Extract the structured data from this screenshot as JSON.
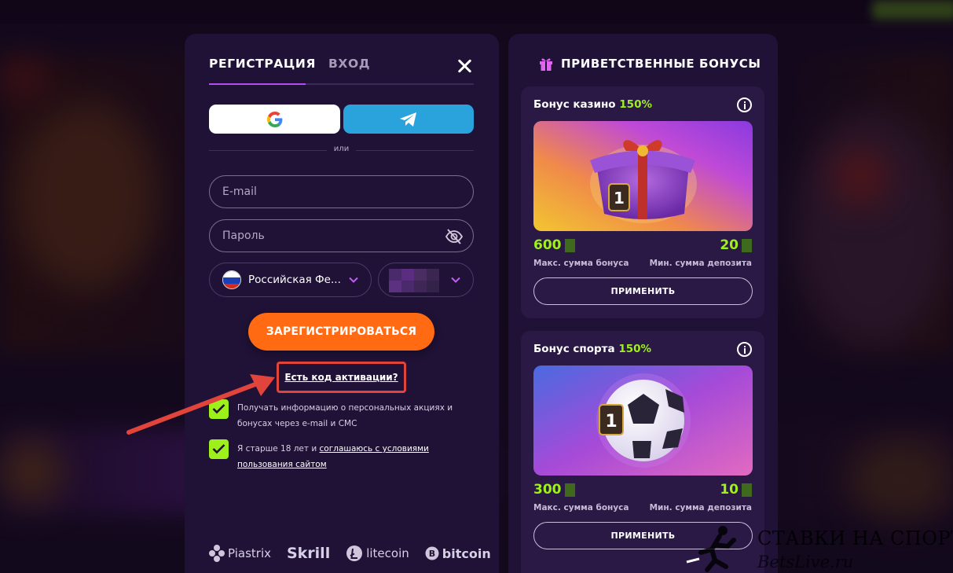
{
  "auth_modal": {
    "tabs": [
      {
        "label": "РЕГИСТРАЦИЯ",
        "active": true
      },
      {
        "label": "ВХОД",
        "active": false
      }
    ],
    "social": {
      "google_icon": "google-icon",
      "telegram_icon": "telegram-icon"
    },
    "or_text": "или",
    "email_placeholder": "E-mail",
    "password_placeholder": "Пароль",
    "country_value": "Российская Фе...",
    "register_label": "ЗАРЕГИСТРИРОВАТЬСЯ",
    "activation_code_link": "Есть код активации?",
    "checkbox_promo": {
      "line1": "Получать информацию о персональных акциях и",
      "line2": "бонусах через e-mail и СМС",
      "checked": true
    },
    "checkbox_terms": {
      "prefix": "Я старше 18 лет и ",
      "link_part1": "соглашаюсь с условиями",
      "link_part2": "пользования сайтом",
      "checked": true
    },
    "payments": [
      "Piastrix",
      "Skrill",
      "litecoin",
      "bitcoin"
    ]
  },
  "bonus_panel": {
    "title": "ПРИВЕТСТВЕННЫЕ БОНУСЫ",
    "cards": [
      {
        "name": "Бонус казино",
        "percent": "150%",
        "max_value": "600",
        "min_value": "20",
        "max_label": "Макс. сумма бонуса",
        "min_label": "Мин. сумма депозита",
        "apply_label": "ПРИМЕНИТЬ"
      },
      {
        "name": "Бонус спорта",
        "percent": "150%",
        "max_value": "300",
        "min_value": "10",
        "max_label": "Макс. сумма бонуса",
        "min_label": "Мин. сумма депозита",
        "apply_label": "ПРИМЕНИТЬ"
      }
    ]
  },
  "watermark": {
    "line1": "СТАВКИ НА СПОРТ",
    "line2": "BetsLive.ru"
  },
  "colors": {
    "accent_green": "#9ef01a",
    "register_orange": "#ff6a13",
    "panel_bg": "#1f1236",
    "telegram_blue": "#2aa3dd",
    "highlight_red": "#e0443a"
  }
}
